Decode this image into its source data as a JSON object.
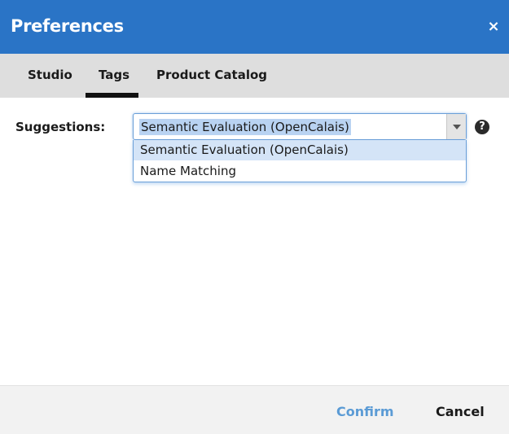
{
  "dialog": {
    "title": "Preferences",
    "close_icon": "close-icon",
    "close_glyph": "×"
  },
  "tabs": [
    {
      "label": "Studio",
      "selected": false
    },
    {
      "label": "Tags",
      "selected": true
    },
    {
      "label": "Product Catalog",
      "selected": false
    }
  ],
  "suggestions": {
    "label": "Suggestions:",
    "selected_value": "Semantic Evaluation (OpenCalais)",
    "options": [
      {
        "label": "Semantic Evaluation (OpenCalais)",
        "highlighted": true
      },
      {
        "label": "Name Matching",
        "highlighted": false
      }
    ],
    "help_icon": "question-circle-icon",
    "help_glyph": "?"
  },
  "footer": {
    "confirm_label": "Confirm",
    "cancel_label": "Cancel"
  },
  "colors": {
    "title_bar": "#2a74c6",
    "tab_bar": "#dedede",
    "selection_highlight": "#b9d3f2",
    "confirm_text": "#5b9bd5"
  }
}
